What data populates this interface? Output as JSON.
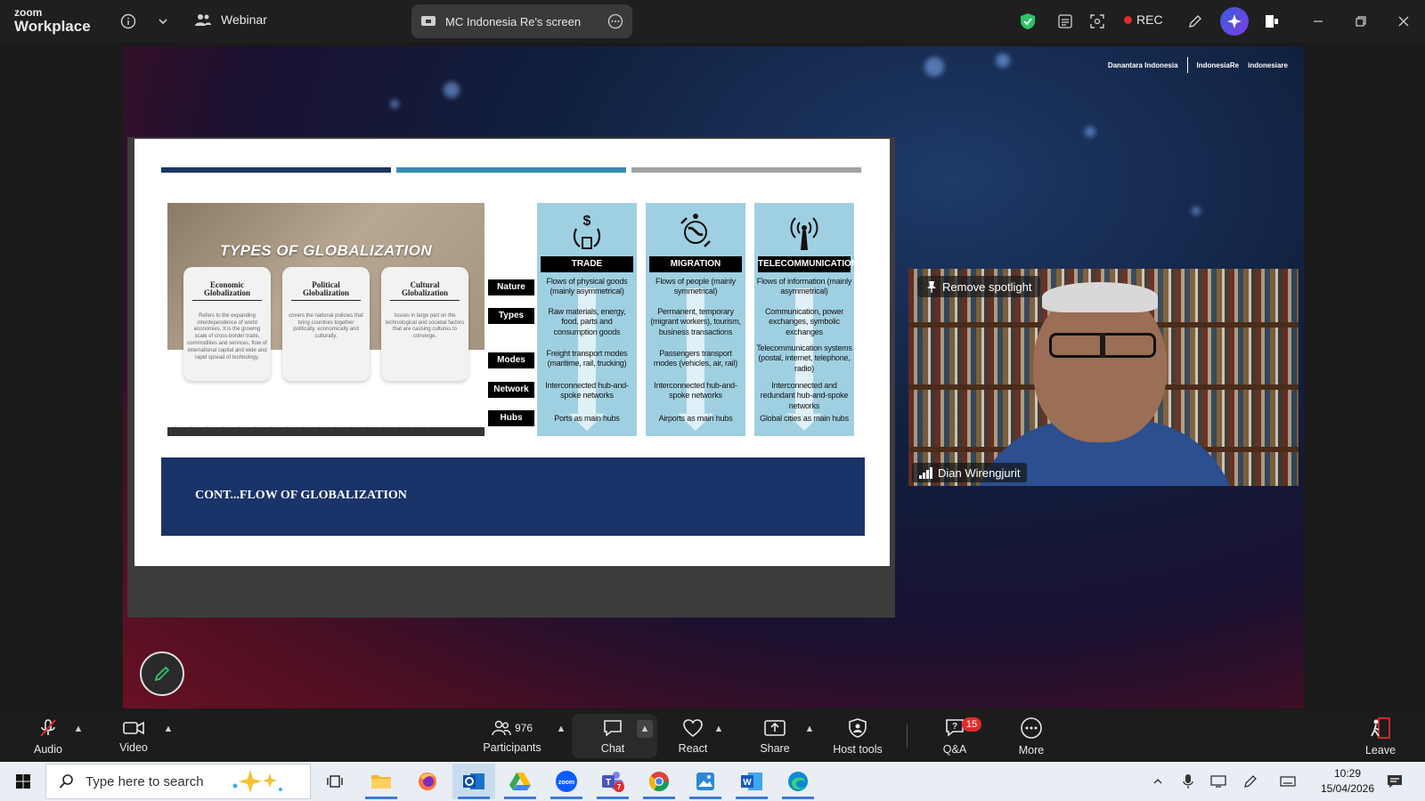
{
  "titlebar": {
    "logo_top": "zoom",
    "logo_bottom": "Workplace",
    "webinar_label": "Webinar",
    "share_tab_label": "MC Indonesia Re's screen",
    "rec_label": "REC"
  },
  "slide": {
    "photo_title": "TYPES OF GLOBALIZATION",
    "cards": [
      {
        "heading": "Economic Globalization",
        "text": "Refers to the expanding interdependence of world economies. It is the growing scale of cross-border trade, commodities and services, flow of international capital and wide and rapid spread of technology."
      },
      {
        "heading": "Political Globalization",
        "text": "covers the national policies that bring countries together politically, economically and culturally."
      },
      {
        "heading": "Cultural Globalization",
        "text": "Issues in large part on the technological and societal factors that are causing cultures to converge."
      }
    ],
    "row_labels": [
      "Nature",
      "Types",
      "Modes",
      "Network",
      "Hubs"
    ],
    "columns": [
      {
        "head": "TRADE",
        "icon": "trade-icon",
        "nature": "Flows of physical goods (mainly asymmetrical)",
        "types": "Raw materials, energy, food, parts and consumption goods",
        "modes": "Freight transport modes (maritime, rail, trucking)",
        "network": "Interconnected hub-and-spoke networks",
        "hubs": "Ports as main hubs"
      },
      {
        "head": "MIGRATION",
        "icon": "migration-icon",
        "nature": "Flows of people (mainly symmetrical)",
        "types": "Permanent, temporary (migrant workers), tourism, business transactions",
        "modes": "Passengers transport modes (vehicles, air, rail)",
        "network": "Interconnected hub-and-spoke networks",
        "hubs": "Airports as main hubs"
      },
      {
        "head": "TELECOMMUNICATIONS",
        "icon": "telecom-icon",
        "nature": "Flows of information (mainly asymmetrical)",
        "types": "Communication, power exchanges, symbolic exchanges",
        "modes": "Telecommunication systems (postal, internet, telephone, radio)",
        "network": "Interconnected and redundant hub-and-spoke networks",
        "hubs": "Global cities as main hubs"
      }
    ],
    "banner_text": "CONT...FLOW OF GLOBALIZATION"
  },
  "stage_logos": {
    "left": "Danantara Indonesia",
    "middle": "IndonesiaRe",
    "right": "indonesiare"
  },
  "video": {
    "spotlight_label": "Remove spotlight",
    "participant_name": "Dian Wirengjurit"
  },
  "toolbar": {
    "audio": "Audio",
    "video": "Video",
    "participants": "Participants",
    "participants_count": "976",
    "chat": "Chat",
    "react": "React",
    "share": "Share",
    "host_tools": "Host tools",
    "qa": "Q&A",
    "qa_badge": "15",
    "more": "More",
    "leave": "Leave"
  },
  "taskbar": {
    "search_placeholder": "Type here to search",
    "time": "10:29",
    "date": "15/04/2026",
    "teams_badge": "7"
  },
  "colors": {
    "bar_dark": "#1f3664",
    "bar_mid": "#3a8ab5",
    "bar_gray": "#a3a3a3",
    "column_bg": "#9fd0e2",
    "banner_bg": "#1a3368",
    "rec_red": "#e02b2b",
    "shield_green": "#2ec26b"
  }
}
